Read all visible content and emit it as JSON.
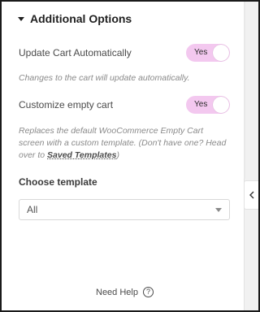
{
  "section": {
    "title": "Additional Options"
  },
  "update_cart": {
    "label": "Update Cart Automatically",
    "toggle_label": "Yes",
    "enabled": true,
    "description": "Changes to the cart will update automatically."
  },
  "empty_cart": {
    "label": "Customize empty cart",
    "toggle_label": "Yes",
    "enabled": true,
    "description_prefix": "Replaces the default WooCommerce Empty Cart screen with a custom template. (Don't have one? Head over to ",
    "link_text": "Saved Templates",
    "description_suffix": ")"
  },
  "template": {
    "label": "Choose template",
    "selected": "All"
  },
  "footer": {
    "help_label": "Need Help",
    "help_icon": "question-circle-icon"
  },
  "sidebar": {
    "collapse_icon": "chevron-left-icon"
  },
  "colors": {
    "toggle_on": "#f3c8ef",
    "border": "#1a1a1a"
  }
}
